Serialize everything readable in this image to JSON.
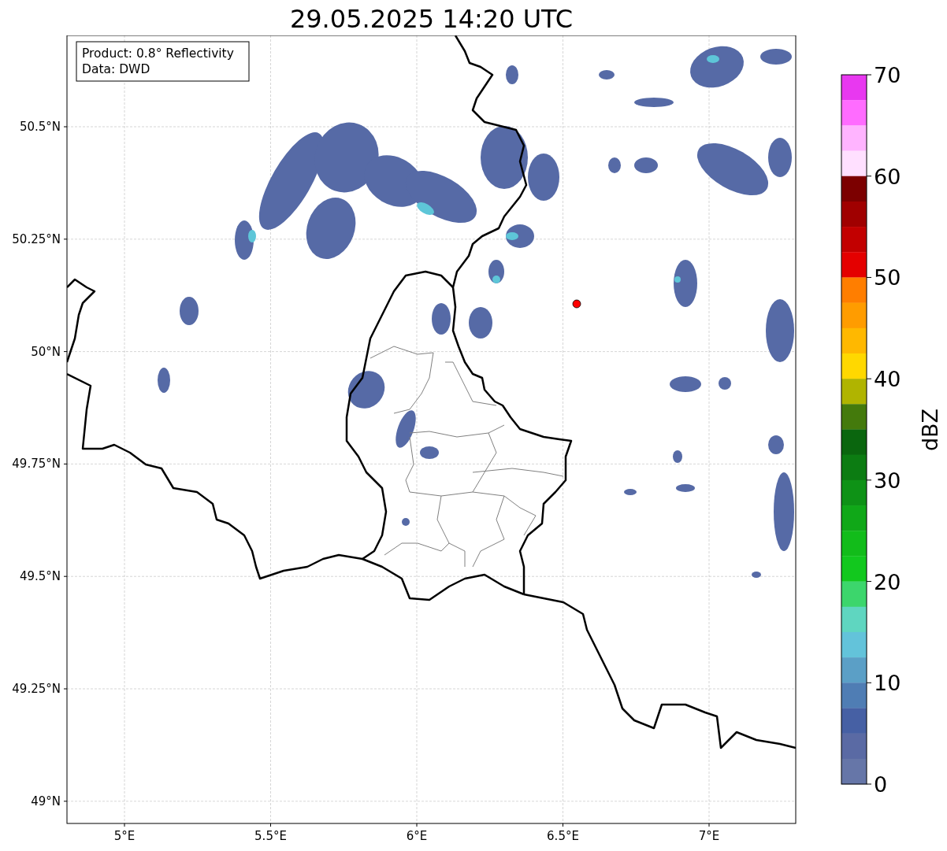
{
  "title": "29.05.2025 14:20 UTC",
  "info_box": {
    "lines": [
      "Product: 0.8° Reflectivity",
      "Data: DWD"
    ]
  },
  "map": {
    "xticks": [
      "5°E",
      "5.5°E",
      "6°E",
      "6.5°E",
      "7°E"
    ],
    "yticks": [
      "50.5°N",
      "50.25°N",
      "50°N",
      "49.75°N",
      "49.5°N",
      "49.25°N",
      "49°N"
    ]
  },
  "colorbar": {
    "label": "dBZ",
    "ticks": [
      "70",
      "60",
      "50",
      "40",
      "30",
      "20",
      "10",
      "0"
    ],
    "segments": [
      {
        "color": "#e838f0"
      },
      {
        "color": "#ff6cff"
      },
      {
        "color": "#ffb4ff"
      },
      {
        "color": "#ffe0ff"
      },
      {
        "color": "#7c0000"
      },
      {
        "color": "#a00000"
      },
      {
        "color": "#c20000"
      },
      {
        "color": "#e40000"
      },
      {
        "color": "#ff7e00"
      },
      {
        "color": "#ff9c00"
      },
      {
        "color": "#ffb800"
      },
      {
        "color": "#ffd800"
      },
      {
        "color": "#b0b400"
      },
      {
        "color": "#447a0c"
      },
      {
        "color": "#0a660e"
      },
      {
        "color": "#0c7c12"
      },
      {
        "color": "#0e9216"
      },
      {
        "color": "#10a818"
      },
      {
        "color": "#12bc1a"
      },
      {
        "color": "#12c81e"
      },
      {
        "color": "#3cd66c"
      },
      {
        "color": "#5fd6c0"
      },
      {
        "color": "#63c3da"
      },
      {
        "color": "#5b9fc6"
      },
      {
        "color": "#4f7db4"
      },
      {
        "color": "#4660a4"
      },
      {
        "color": "#5a6aa4"
      },
      {
        "color": "#6676a8"
      }
    ]
  }
}
